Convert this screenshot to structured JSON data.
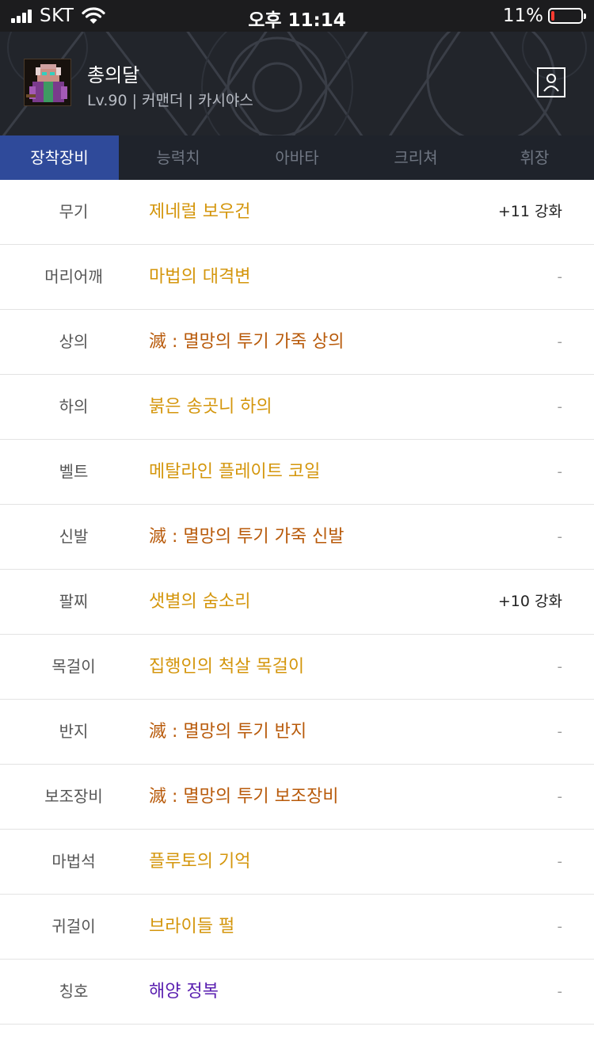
{
  "status_bar": {
    "carrier": "SKT",
    "time": "오후 11:14",
    "battery_percent": "11%",
    "battery_level": 0.11,
    "battery_color": "#ff3b30"
  },
  "character": {
    "name": "총의달",
    "info": "Lv.90 | 커맨더 | 카시야스"
  },
  "tabs": [
    {
      "label": "장착장비",
      "active": true
    },
    {
      "label": "능력치",
      "active": false
    },
    {
      "label": "아바타",
      "active": false
    },
    {
      "label": "크리쳐",
      "active": false
    },
    {
      "label": "휘장",
      "active": false
    }
  ],
  "colors": {
    "unique": "#d4960c",
    "epic": "#b85a0a",
    "legendary_purple": "#5a1fb0",
    "active_tab": "#2f4a9a",
    "header_bg": "#22252b"
  },
  "equipment": [
    {
      "slot": "무기",
      "item": "제네럴 보우건",
      "enhance": "+11 강화",
      "color": "#d4960c"
    },
    {
      "slot": "머리어깨",
      "item": "마법의 대격변",
      "enhance": "-",
      "color": "#d4960c"
    },
    {
      "slot": "상의",
      "item": "滅 : 멸망의 투기 가죽 상의",
      "enhance": "-",
      "color": "#b85a0a"
    },
    {
      "slot": "하의",
      "item": "붉은 송곳니 하의",
      "enhance": "-",
      "color": "#d4960c"
    },
    {
      "slot": "벨트",
      "item": "메탈라인 플레이트 코일",
      "enhance": "-",
      "color": "#d4960c"
    },
    {
      "slot": "신발",
      "item": "滅 : 멸망의 투기 가죽 신발",
      "enhance": "-",
      "color": "#b85a0a"
    },
    {
      "slot": "팔찌",
      "item": "샛별의 숨소리",
      "enhance": "+10 강화",
      "color": "#d4960c"
    },
    {
      "slot": "목걸이",
      "item": "집행인의 척살 목걸이",
      "enhance": "-",
      "color": "#d4960c"
    },
    {
      "slot": "반지",
      "item": "滅 : 멸망의 투기 반지",
      "enhance": "-",
      "color": "#b85a0a"
    },
    {
      "slot": "보조장비",
      "item": "滅 : 멸망의 투기 보조장비",
      "enhance": "-",
      "color": "#b85a0a"
    },
    {
      "slot": "마법석",
      "item": "플루토의 기억",
      "enhance": "-",
      "color": "#d4960c"
    },
    {
      "slot": "귀걸이",
      "item": "브라이들 펄",
      "enhance": "-",
      "color": "#d4960c"
    },
    {
      "slot": "칭호",
      "item": "해양 정복",
      "enhance": "-",
      "color": "#5a1fb0"
    }
  ]
}
